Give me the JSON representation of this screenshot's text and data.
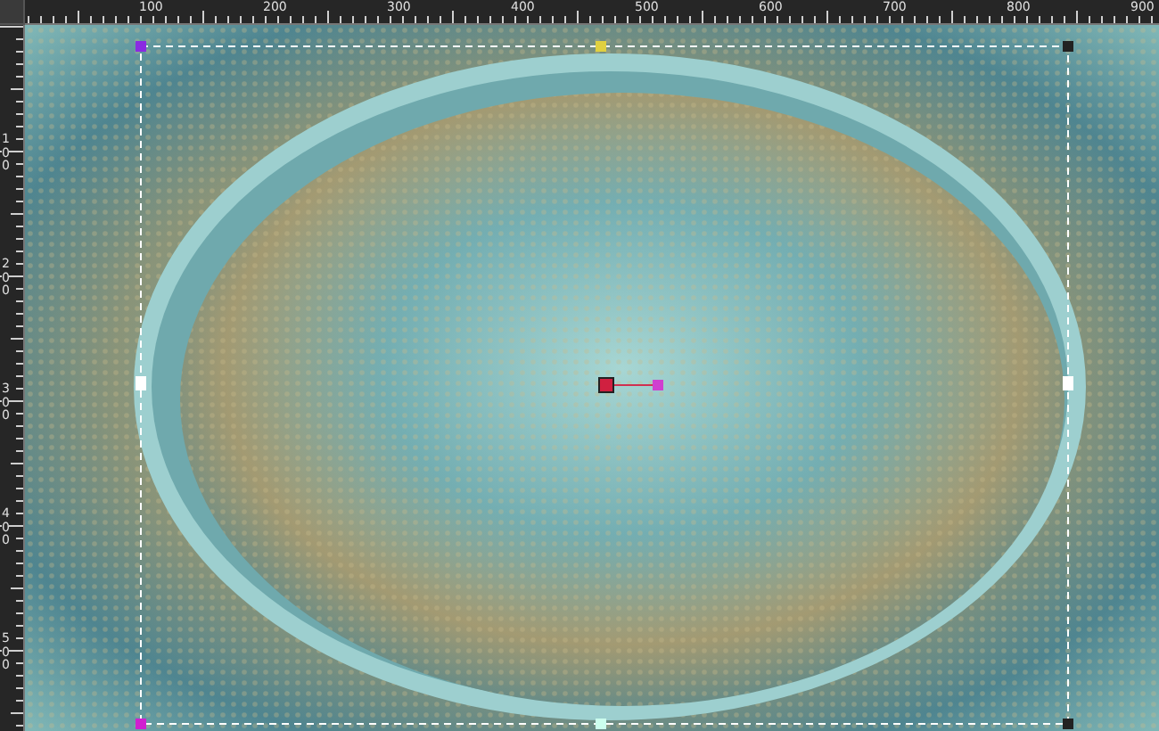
{
  "rulers": {
    "horizontal": [
      "100",
      "200",
      "300",
      "400",
      "500",
      "600",
      "700",
      "800",
      "900"
    ],
    "vertical": [
      "100",
      "200",
      "300",
      "400",
      "500"
    ]
  }
}
